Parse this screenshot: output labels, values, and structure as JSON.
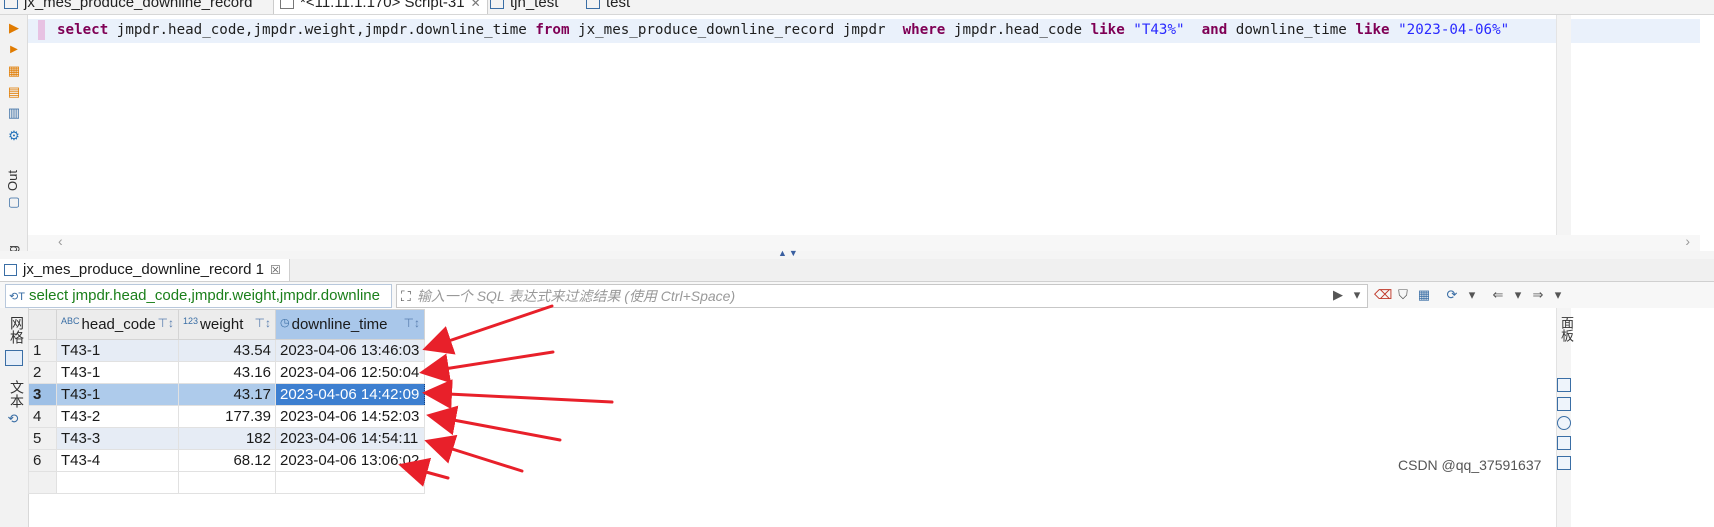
{
  "tabs": [
    {
      "label": "jx_mes_produce_downline_record",
      "closable": false
    },
    {
      "label": "*<11.11.1.170> Script-31",
      "closable": true
    },
    {
      "label": "tjn_test",
      "closable": false
    },
    {
      "label": "test",
      "closable": false
    }
  ],
  "gutter": {
    "out_label": "Out",
    "log_label": "Log"
  },
  "editor": {
    "tokens": [
      {
        "t": "select",
        "k": "kw"
      },
      {
        "t": " jmpdr.head_code,jmpdr.weight,jmpdr.downline_time ",
        "k": ""
      },
      {
        "t": "from",
        "k": "kw"
      },
      {
        "t": " jx_mes_produce_downline_record jmpdr  ",
        "k": ""
      },
      {
        "t": "where",
        "k": "kw"
      },
      {
        "t": " jmpdr.head_code ",
        "k": ""
      },
      {
        "t": "like",
        "k": "kw"
      },
      {
        "t": " ",
        "k": ""
      },
      {
        "t": "\"T43%\"",
        "k": "str"
      },
      {
        "t": "  ",
        "k": ""
      },
      {
        "t": "and",
        "k": "kw"
      },
      {
        "t": " downline_time ",
        "k": ""
      },
      {
        "t": "like",
        "k": "kw"
      },
      {
        "t": " ",
        "k": ""
      },
      {
        "t": "\"2023-04-06%\"",
        "k": "str"
      }
    ]
  },
  "results": {
    "tab_label": "jx_mes_produce_downline_record 1",
    "filter_sql": "select jmpdr.head_code,jmpdr.weight,jmpdr.downline",
    "filter_placeholder": "输入一个 SQL 表达式来过滤结果 (使用 Ctrl+Space)",
    "side_tabs": {
      "grid": "网格",
      "text": "文本"
    },
    "right_panel_label": "面板",
    "columns": [
      {
        "type": "ABC",
        "name": "head_code"
      },
      {
        "type": "123",
        "name": "weight"
      },
      {
        "type": "clock",
        "name": "downline_time"
      }
    ],
    "rows": [
      {
        "n": "1",
        "head_code": "T43-1",
        "weight": "43.54",
        "downline_time": "2023-04-06 13:46:03"
      },
      {
        "n": "2",
        "head_code": "T43-1",
        "weight": "43.16",
        "downline_time": "2023-04-06 12:50:04"
      },
      {
        "n": "3",
        "head_code": "T43-1",
        "weight": "43.17",
        "downline_time": "2023-04-06 14:42:09"
      },
      {
        "n": "4",
        "head_code": "T43-2",
        "weight": "177.39",
        "downline_time": "2023-04-06 14:52:03"
      },
      {
        "n": "5",
        "head_code": "T43-3",
        "weight": "182",
        "downline_time": "2023-04-06 14:54:11"
      },
      {
        "n": "6",
        "head_code": "T43-4",
        "weight": "68.12",
        "downline_time": "2023-04-06 13:06:02"
      }
    ],
    "selected_row": "3"
  },
  "annotation_color": "#e8202a",
  "watermark": "CSDN @qq_37591637"
}
